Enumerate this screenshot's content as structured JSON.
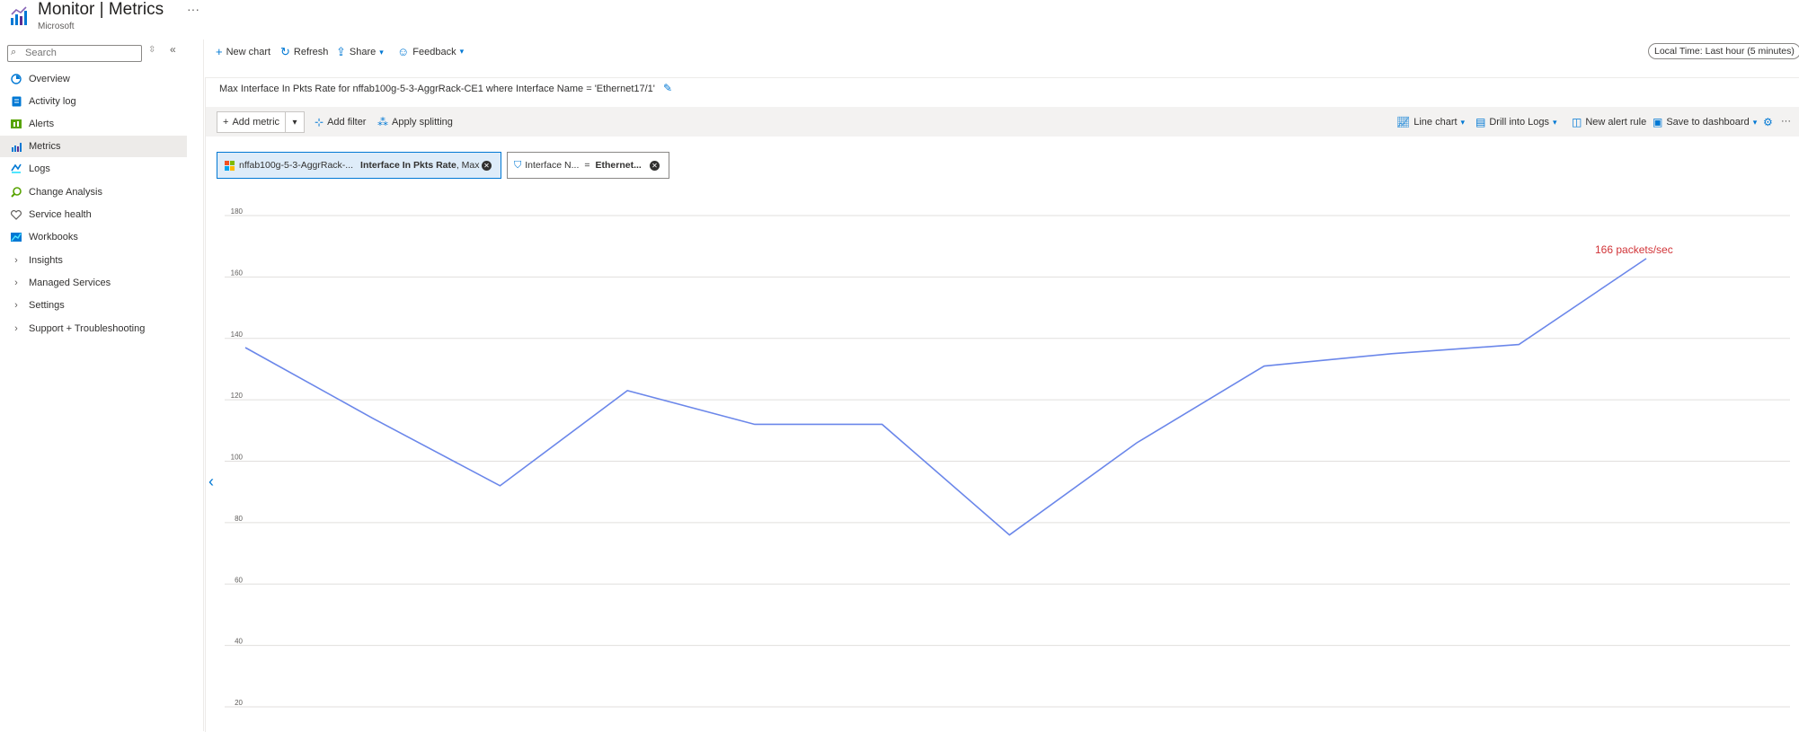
{
  "header": {
    "title": "Monitor | Metrics",
    "subtitle": "Microsoft",
    "more": "···"
  },
  "sidebar": {
    "search_placeholder": "Search",
    "items": [
      {
        "label": "Overview",
        "icon": "overview-icon"
      },
      {
        "label": "Activity log",
        "icon": "activity-log-icon"
      },
      {
        "label": "Alerts",
        "icon": "alerts-icon"
      },
      {
        "label": "Metrics",
        "icon": "metrics-icon",
        "active": true
      },
      {
        "label": "Logs",
        "icon": "logs-icon"
      },
      {
        "label": "Change Analysis",
        "icon": "change-analysis-icon"
      },
      {
        "label": "Service health",
        "icon": "service-health-icon"
      },
      {
        "label": "Workbooks",
        "icon": "workbooks-icon"
      },
      {
        "label": "Insights",
        "expandable": true
      },
      {
        "label": "Managed Services",
        "expandable": true
      },
      {
        "label": "Settings",
        "expandable": true
      },
      {
        "label": "Support + Troubleshooting",
        "expandable": true
      }
    ]
  },
  "toolbar": {
    "new_chart": "New chart",
    "refresh": "Refresh",
    "share": "Share",
    "feedback": "Feedback",
    "time_range": "Local Time: Last hour (5 minutes)"
  },
  "chart": {
    "title": "Max Interface In Pkts Rate for nffab100g-5-3-AggrRack-CE1 where Interface Name = 'Ethernet17/1'",
    "add_metric": "Add metric",
    "add_filter": "Add filter",
    "apply_splitting": "Apply splitting",
    "line_chart": "Line chart",
    "drill_into_logs": "Drill into Logs",
    "new_alert_rule": "New alert rule",
    "save_to_dashboard": "Save to dashboard",
    "metric_pill": {
      "resource": "nffab100g-5-3-AggrRack-...",
      "metric": "Interface In Pkts Rate",
      "aggregation": ", Max"
    },
    "filter_pill": {
      "name": "Interface N...",
      "operator": "=",
      "value": "Ethernet..."
    },
    "annotation": "166 packets/sec",
    "accent": "#0078d4",
    "line_color": "#6b87ea",
    "annotation_color": "#d13438"
  },
  "chart_data": {
    "type": "line",
    "title": "Max Interface In Pkts Rate for nffab100g-5-3-AggrRack-CE1 where Interface Name = 'Ethernet17/1'",
    "xlabel": "",
    "ylabel": "",
    "yticks": [
      20,
      40,
      60,
      80,
      100,
      120,
      140,
      160,
      180
    ],
    "ylim": [
      20,
      180
    ],
    "grid": true,
    "series": [
      {
        "values": [
          137,
          114,
          92,
          123,
          112,
          112,
          76,
          106,
          131,
          135,
          138,
          166
        ]
      }
    ],
    "annotation": {
      "label": "166 packets/sec",
      "index": 11
    }
  }
}
